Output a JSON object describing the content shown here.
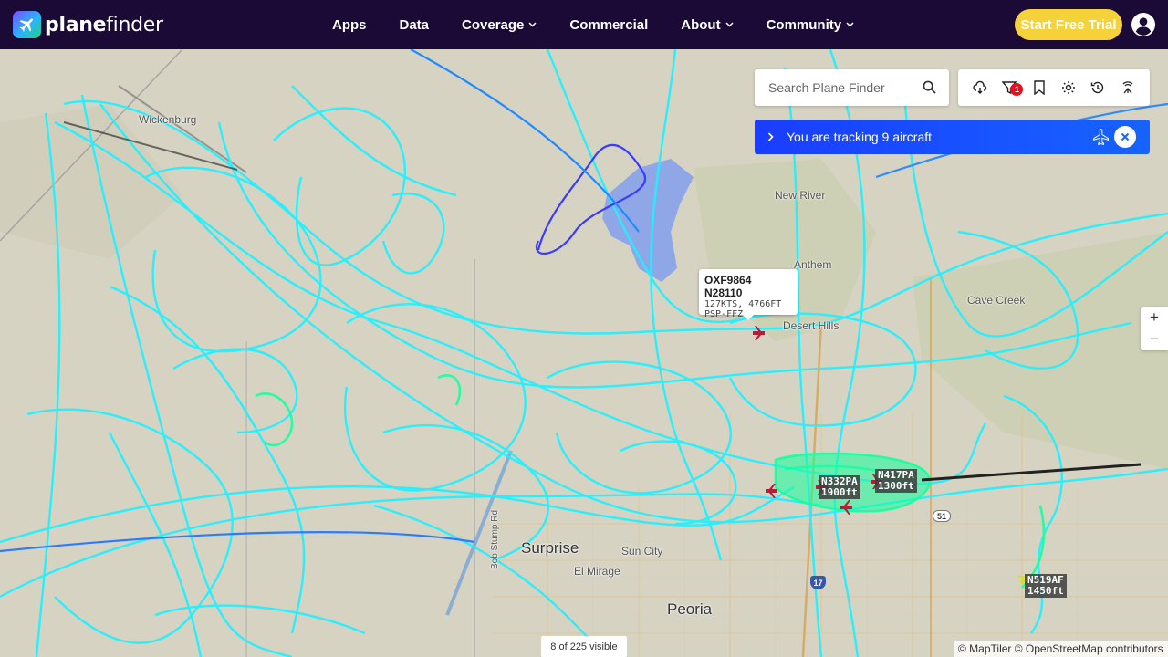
{
  "brand": {
    "name_bold": "plane",
    "name_light": "finder"
  },
  "nav": {
    "items": [
      {
        "label": "Apps",
        "dropdown": false
      },
      {
        "label": "Data",
        "dropdown": false
      },
      {
        "label": "Coverage",
        "dropdown": true
      },
      {
        "label": "Commercial",
        "dropdown": false
      },
      {
        "label": "About",
        "dropdown": true
      },
      {
        "label": "Community",
        "dropdown": true
      }
    ],
    "cta": "Start Free Trial"
  },
  "search": {
    "placeholder": "Search Plane Finder"
  },
  "toolbar": {
    "icons": [
      "weather-icon",
      "filter-icon",
      "bookmark-icon",
      "settings-icon",
      "history-icon",
      "radar-icon"
    ],
    "filter_badge": "1"
  },
  "tracking": {
    "text": "You are tracking 9 aircraft"
  },
  "zoom": {
    "in": "+",
    "out": "−"
  },
  "popup": {
    "title": "OXF9864 N28110",
    "line2": "127KTS, 4766FT",
    "line3": "PSP-FFZ"
  },
  "aircraft_labels": [
    {
      "callsign": "N332PA",
      "alt": "1900ft"
    },
    {
      "callsign": "N417PA",
      "alt": "1300ft"
    },
    {
      "callsign": "N519AF",
      "alt": "1450ft"
    }
  ],
  "places": {
    "wickenburg": "Wickenburg",
    "new_river": "New River",
    "anthem": "Anthem",
    "cave_creek": "Cave Creek",
    "desert_hills": "Desert Hills",
    "surprise": "Surprise",
    "sun_city": "Sun City",
    "el_mirage": "El Mirage",
    "peoria": "Peoria",
    "bob_stump": "Bob Stump Rd",
    "shield_17": "17",
    "shield_51": "51"
  },
  "footer": {
    "visible": "8 of 225 visible",
    "attribution": "© MapTiler © OpenStreetMap contributors"
  },
  "colors": {
    "navbar": "#1a0a35",
    "cta": "#f5d23a",
    "tracking": "#1663ff",
    "track_cyan": "#1ff3ff",
    "track_green": "#13ffa8"
  }
}
